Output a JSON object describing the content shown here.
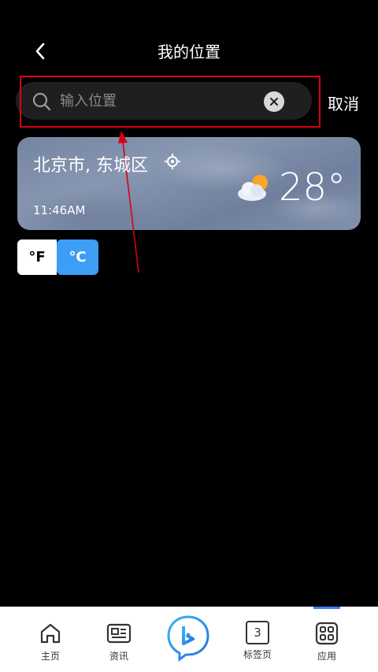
{
  "header": {
    "title": "我的位置"
  },
  "search": {
    "placeholder": "输入位置",
    "value": "",
    "cancel_label": "取消"
  },
  "weather_card": {
    "city": "北京市, 东城区",
    "time": "11:46AM",
    "temperature": "28°",
    "condition_icon": "partly-cloudy-icon"
  },
  "units": {
    "fahrenheit": "°F",
    "celsius": "°C",
    "selected": "celsius"
  },
  "annotation": {
    "highlight_color": "#d90012"
  },
  "bottom_nav": {
    "items": [
      {
        "label": "主页",
        "icon": "home-icon"
      },
      {
        "label": "资讯",
        "icon": "news-icon"
      },
      {
        "label": "",
        "icon": "bing-icon"
      },
      {
        "label": "标签页",
        "icon": "tabs-icon",
        "count": "3"
      },
      {
        "label": "应用",
        "icon": "apps-icon"
      }
    ],
    "active_index": 4
  },
  "colors": {
    "accent": "#3d9df7",
    "background": "#000000"
  }
}
